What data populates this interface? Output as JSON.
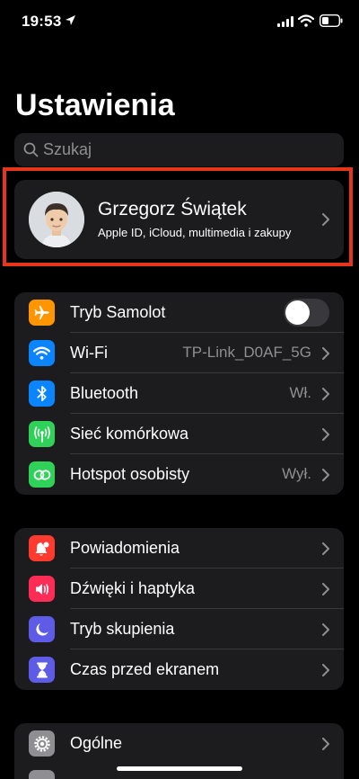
{
  "status_bar": {
    "time": "19:53"
  },
  "title": "Ustawienia",
  "search": {
    "placeholder": "Szukaj"
  },
  "profile": {
    "name": "Grzegorz Świątek",
    "subtitle": "Apple ID, iCloud, multimedia i zakupy"
  },
  "groups": [
    {
      "items": [
        {
          "label": "Tryb Samolot",
          "icon": "airplane-icon",
          "color": "#ff9500",
          "toggle": false
        },
        {
          "label": "Wi-Fi",
          "value": "TP-Link_D0AF_5G",
          "icon": "wifi-icon",
          "color": "#0a84ff"
        },
        {
          "label": "Bluetooth",
          "value": "Wł.",
          "icon": "bluetooth-icon",
          "color": "#0a84ff"
        },
        {
          "label": "Sieć komórkowa",
          "icon": "cellular-icon",
          "color": "#30d158"
        },
        {
          "label": "Hotspot osobisty",
          "value": "Wył.",
          "icon": "hotspot-icon",
          "color": "#30d158"
        }
      ]
    },
    {
      "items": [
        {
          "label": "Powiadomienia",
          "icon": "bell-icon",
          "color": "#ff3b30"
        },
        {
          "label": "Dźwięki i haptyka",
          "icon": "speaker-icon",
          "color": "#ff2d55"
        },
        {
          "label": "Tryb skupienia",
          "icon": "moon-icon",
          "color": "#5e5ce6"
        },
        {
          "label": "Czas przed ekranem",
          "icon": "hourglass-icon",
          "color": "#5e5ce6"
        }
      ]
    },
    {
      "items": [
        {
          "label": "Ogólne",
          "icon": "gear-icon",
          "color": "#8e8e93"
        }
      ]
    }
  ]
}
